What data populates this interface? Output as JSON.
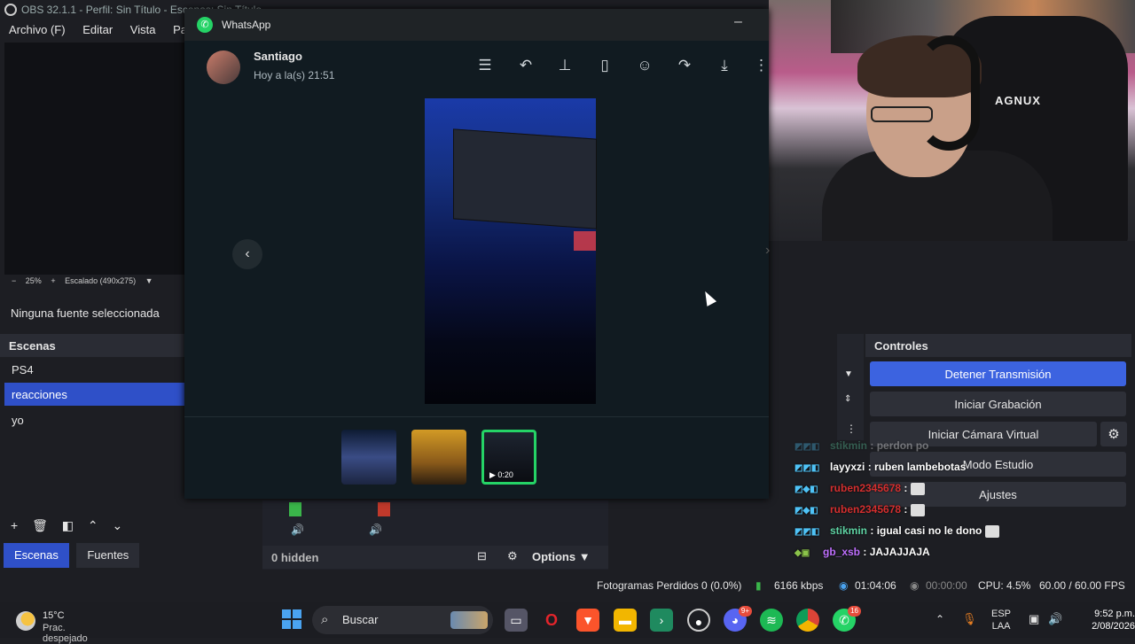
{
  "obs": {
    "title": "OBS 32.1.1 - Perfil: Sin Título - Escenas: Sin Título",
    "menu": [
      "Archivo (F)",
      "Editar",
      "Vista",
      "Paneles"
    ],
    "zoom": "25%",
    "scaled": "Escalado (490x275)",
    "no_source": "Ninguna fuente seleccionada",
    "scenes_title": "Escenas",
    "scenes": [
      "PS4",
      "reacciones",
      "yo"
    ],
    "selected_scene": "reacciones",
    "tabs": [
      "Escenas",
      "Fuentes"
    ],
    "mixer_hidden": "0 hidden",
    "mixer_options": "Options",
    "controls_title": "Controles",
    "controls": {
      "stop_stream": "Detener Transmisión",
      "start_recording": "Iniciar Grabación",
      "start_virtual_cam": "Iniciar Cámara Virtual",
      "studio_mode": "Modo Estudio",
      "settings": "Ajustes"
    },
    "status": {
      "dropped_frames": "Fotogramas Perdidos 0 (0.0%)",
      "bitrate": "6166 kbps",
      "live_time": "01:04:06",
      "rec_time": "00:00:00",
      "cpu": "CPU: 4.5%",
      "fps": "60.00 / 60.00 FPS"
    }
  },
  "chat": [
    {
      "user": "stikmin",
      "msg": ": perdon po",
      "color": "#5fd3a4",
      "faded": true
    },
    {
      "user": "layyxzi",
      "msg": ": ruben lambebotas",
      "color": "#ffffff"
    },
    {
      "user": "ruben2345678",
      "msg": ":",
      "color": "#d32f2f",
      "emote": true
    },
    {
      "user": "ruben2345678",
      "msg": ":",
      "color": "#d32f2f",
      "emote": true
    },
    {
      "user": "stikmin",
      "msg": ": igual casi no le dono",
      "color": "#5fd3a4",
      "emote": true
    },
    {
      "user": "gb_xsb",
      "msg": ": JAJAJJAJA",
      "color": "#c070ff"
    }
  ],
  "webcam": {
    "chair_brand": "AGNUX"
  },
  "whatsapp": {
    "title": "WhatsApp",
    "contact": "Santiago",
    "time": "Hoy a la(s) 21:51",
    "toolbar_icons": [
      "details-icon",
      "reply-icon",
      "pin-icon",
      "bookmark-icon",
      "emoji-icon",
      "forward-icon",
      "download-icon",
      "more-icon"
    ],
    "video_duration": "0:20"
  },
  "taskbar": {
    "temp": "15°C",
    "weather": "Prac. despejado",
    "search_placeholder": "Buscar",
    "lang1": "ESP",
    "lang2": "LAA",
    "time": "9:52 p.m.",
    "date": "2/08/2026",
    "discord_badge": "9+",
    "whatsapp_badge": "16"
  }
}
